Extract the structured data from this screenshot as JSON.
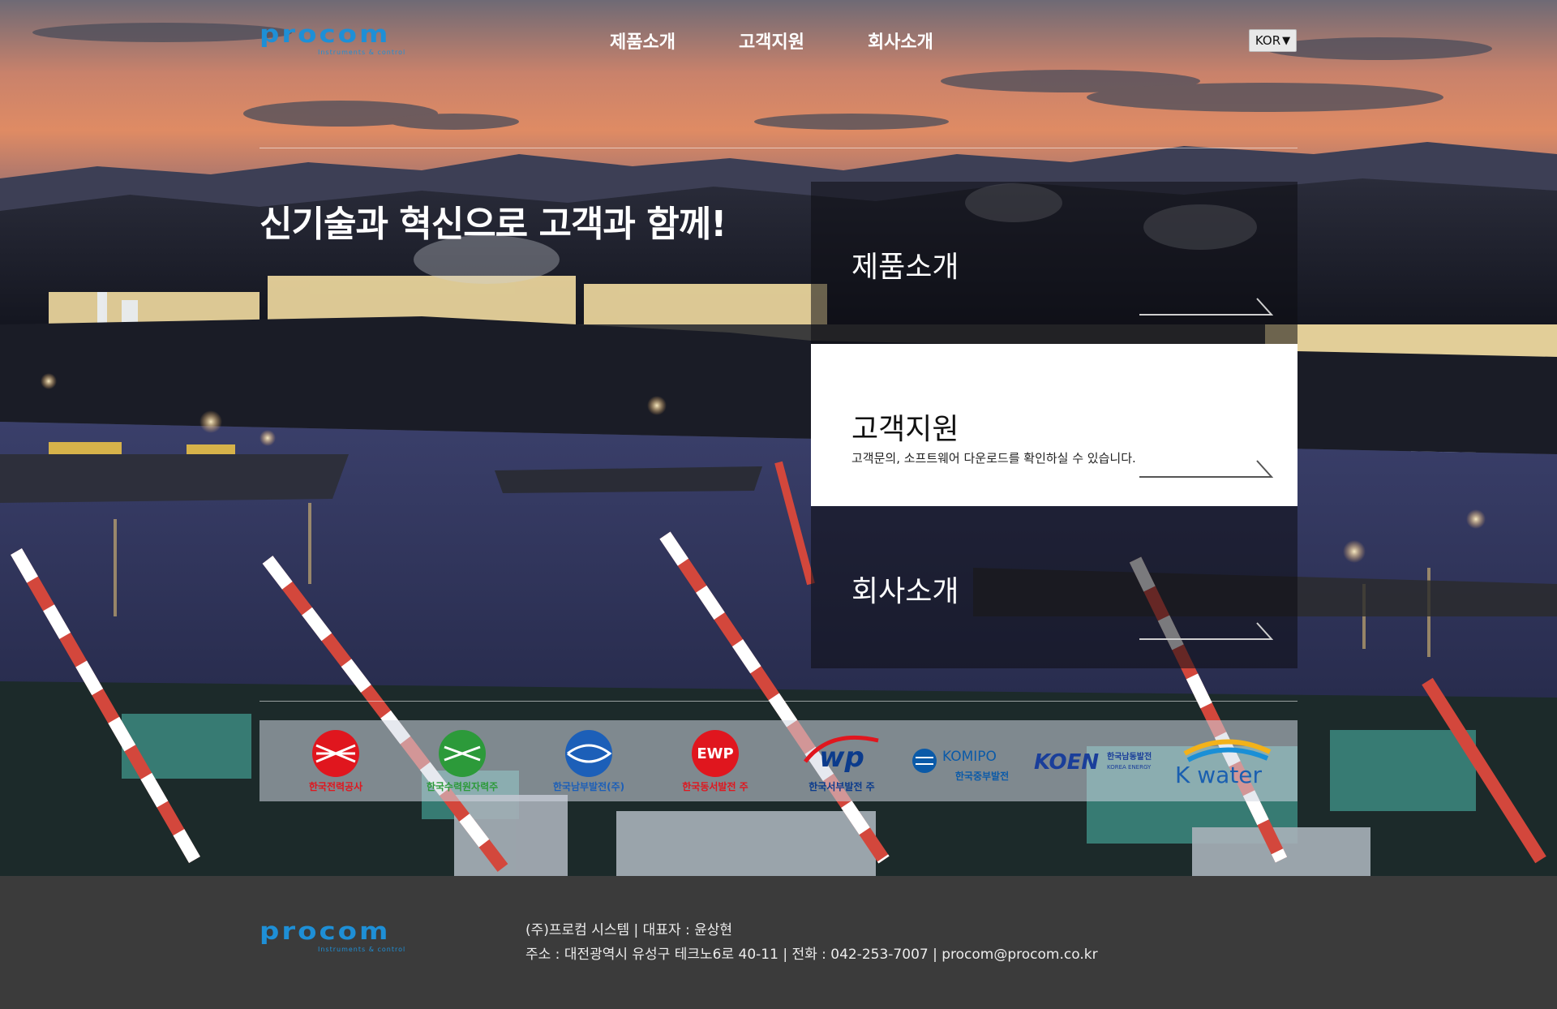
{
  "header": {
    "logo_text": "procom",
    "logo_tagline": "Instruments & control",
    "nav": [
      "제품소개",
      "고객지원",
      "회사소개"
    ],
    "lang": "KOR"
  },
  "hero": {
    "headline": "신기술과 혁신으로 고객과 함께!"
  },
  "cards": [
    {
      "title": "제품소개",
      "desc": ""
    },
    {
      "title": "고객지원",
      "desc": "고객문의, 소프트웨어 다운로드를 확인하실 수 있습니다."
    },
    {
      "title": "회사소개",
      "desc": ""
    }
  ],
  "partners": [
    {
      "name": "한국전력공사",
      "color": "#e0161e"
    },
    {
      "name": "한국수력원자력주",
      "color": "#2c9a3a"
    },
    {
      "name": "한국남부발전(주)",
      "color": "#1c5fb8"
    },
    {
      "name": "한국동서발전 주",
      "color": "#e0161e"
    },
    {
      "name": "한국서부발전 주",
      "color": "#0b3b8c",
      "mark": "wp"
    },
    {
      "name": "한국중부발전",
      "color": "#0b5aa8",
      "mark": "KOMIPO"
    },
    {
      "name": "한국남동발전",
      "color": "#1a3e9a",
      "mark": "KOEN",
      "sub": "KOREA ENERGY"
    },
    {
      "name": "K water",
      "color": "#1a5fb0"
    }
  ],
  "footer": {
    "line1": "(주)프로컴 시스템 | 대표자 : 윤상현",
    "line2": "주소 : 대전광역시 유성구 테크노6로 40-11 | 전화 : 042-253-7007 | procom@procom.co.kr"
  },
  "colors": {
    "logo_blue": "#1e8fd6",
    "footer_bg": "#3b3b3b",
    "card_light": "#ffffff"
  }
}
